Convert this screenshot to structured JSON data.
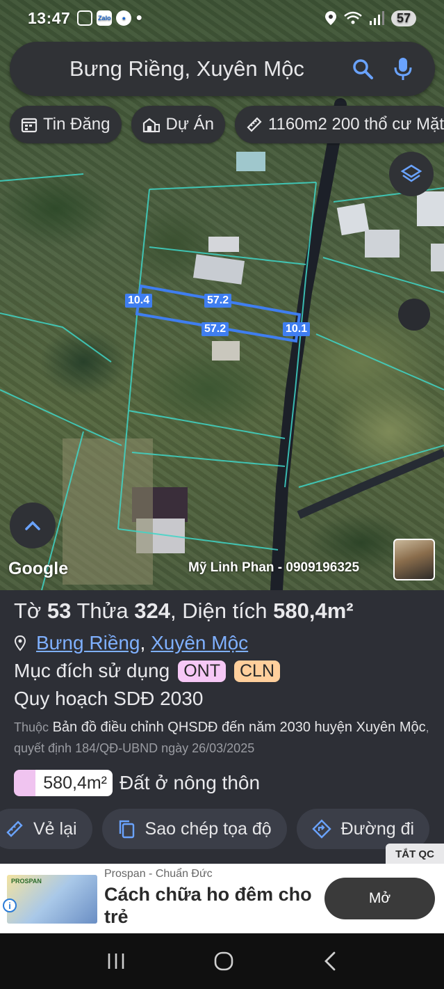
{
  "status_bar": {
    "time": "13:47",
    "app_icons": [
      "Zalo"
    ],
    "battery": "57"
  },
  "search": {
    "query": "Bưng Riềng, Xuyên Mộc",
    "search_icon": "search-icon",
    "mic_icon": "mic-icon"
  },
  "chips": [
    {
      "label": "Tin Đăng",
      "icon": "calendar-icon"
    },
    {
      "label": "Dự Án",
      "icon": "building-icon"
    },
    {
      "label": "1160m2 200 thổ cư Mặt",
      "icon": "ruler-icon"
    }
  ],
  "map": {
    "dimensions": [
      "10.4",
      "57.2",
      "57.2",
      "10.1"
    ],
    "google_logo": "Google",
    "owner_label": "Mỹ Linh Phan - 0909196325",
    "layers_icon": "layers-icon"
  },
  "parcel": {
    "sheet_label": "Tờ",
    "sheet_no": "53",
    "plot_label": "Thửa",
    "plot_no": "324",
    "area_label": ", Diện tích",
    "area_value": "580,4m²",
    "location_parts": [
      "Bưng Riềng",
      ", ",
      "Xuyên Mộc"
    ],
    "purpose_label": "Mục đích sử dụng",
    "purpose_badges": [
      {
        "code": "ONT",
        "color": "#f6c8f6"
      },
      {
        "code": "CLN",
        "color": "#ffcf9c"
      }
    ],
    "plan_title": "Quy hoạch SDĐ 2030",
    "desc_prefix": "Thuộc",
    "desc_main": "Bản đồ điều chỉnh QHSDĐ đến năm 2030 huyện Xuyên Mộc",
    "desc_decision": ", quyết định 184/QĐ-UBND ngày 26/03/2025",
    "zone_area": "580,4m²",
    "zone_label": "Đất ở nông thôn"
  },
  "actions": [
    {
      "label": "Vẻ lại",
      "icon": "redraw-icon"
    },
    {
      "label": "Sao chép tọa độ",
      "icon": "copy-icon"
    },
    {
      "label": "Đường đi",
      "icon": "directions-icon"
    }
  ],
  "ad": {
    "close_label": "TẮT QC",
    "brand": "Prospan - Chuẩn Đức",
    "headline": "Cách chữa ho đêm cho trẻ",
    "cta": "Mở",
    "image_caption": "PROSPAN"
  },
  "colors": {
    "accent_blue": "#3f7ef0",
    "link_blue": "#7fb0ff",
    "panel_bg": "#2d2f36"
  }
}
